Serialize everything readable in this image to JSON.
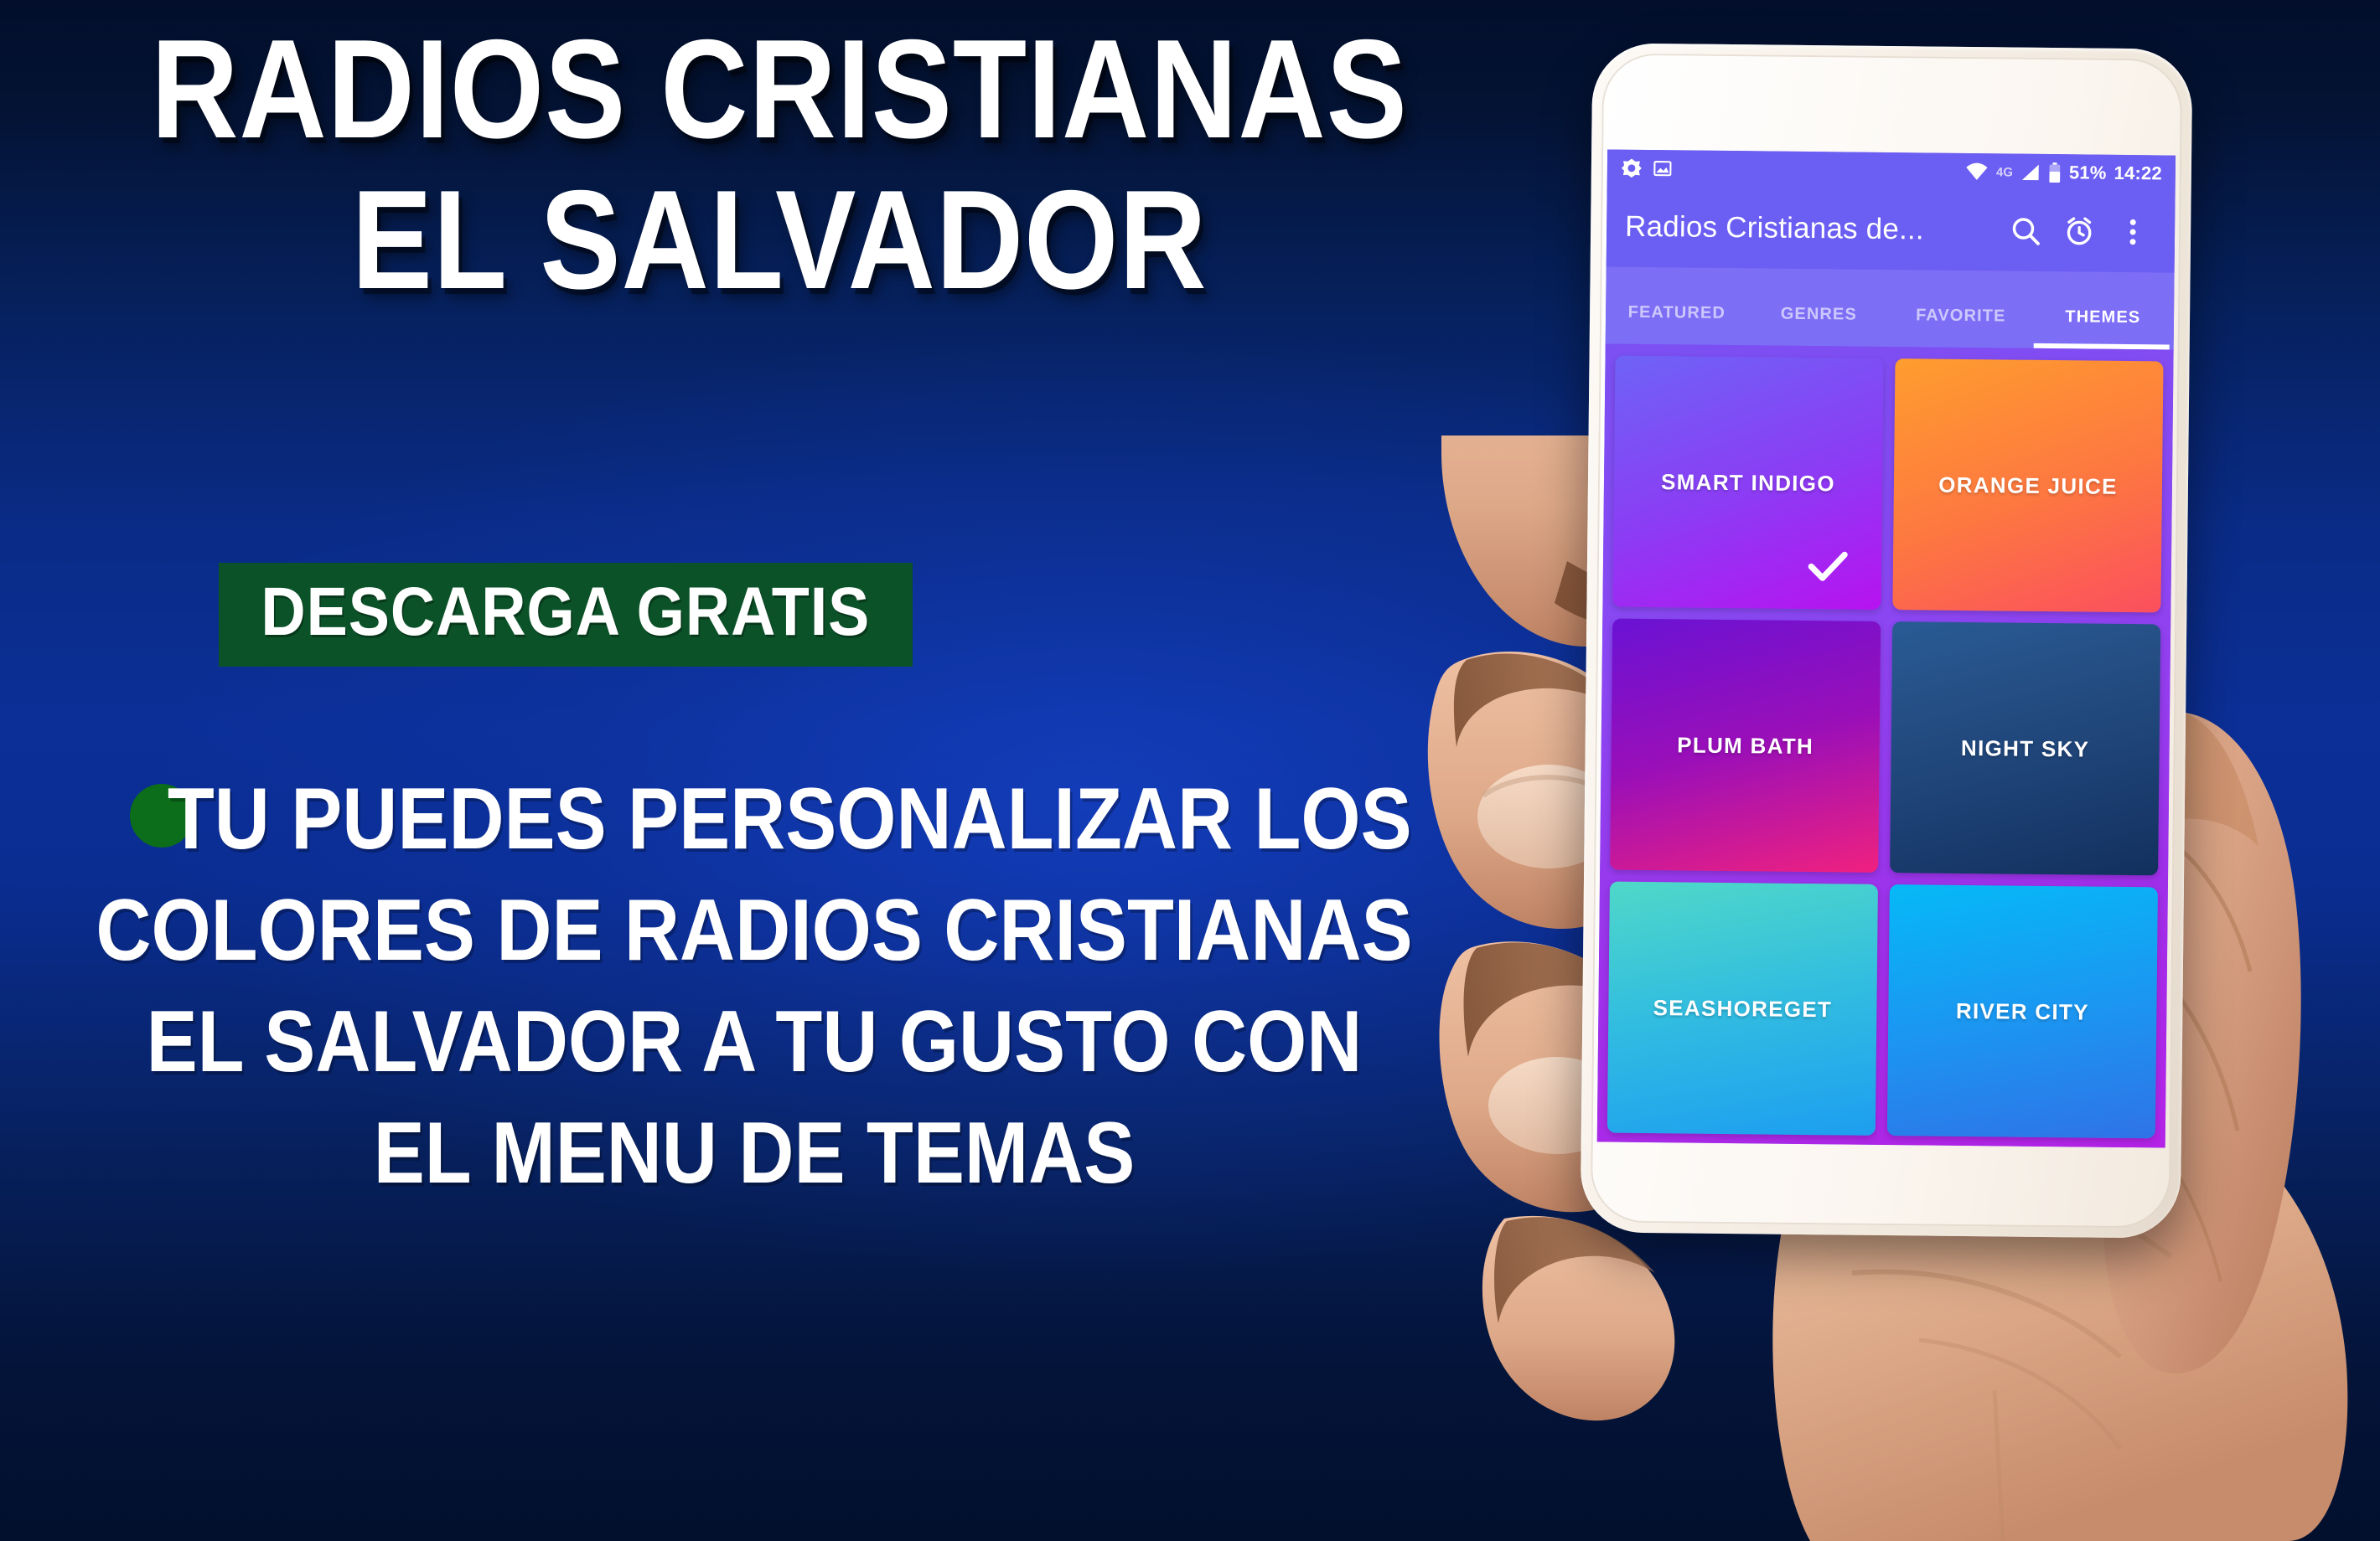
{
  "promo": {
    "headline_line1": "RADIOS CRISTIANAS",
    "headline_line2": "EL SALVADOR",
    "badge_label": "DESCARGA GRATIS",
    "body_lines": [
      "TU PUEDES PERSONALIZAR LOS",
      "COLORES DE RADIOS CRISTIANAS",
      "EL SALVADOR A TU GUSTO CON",
      "EL MENU DE TEMAS"
    ],
    "colors": {
      "background_top": "#02102d",
      "background_mid": "#0b2f97",
      "badge_green": "#0b5228",
      "bullet_green": "#0c6d1b",
      "text_white": "#ffffff"
    }
  },
  "phone": {
    "statusbar": {
      "left_icons": [
        "antivirus-shield-icon",
        "image-notification-icon"
      ],
      "wifi_icon": "wifi-icon",
      "network_label": "4G",
      "signal_icon": "signal-bars-icon",
      "battery_icon": "battery-icon",
      "battery_percent": "51%",
      "clock": "14:22"
    },
    "appbar": {
      "title": "Radios Cristianas de...",
      "actions": [
        {
          "name": "search-icon",
          "label": "Search"
        },
        {
          "name": "alarm-clock-icon",
          "label": "Sleep timer"
        },
        {
          "name": "overflow-menu-icon",
          "label": "More options"
        }
      ],
      "color": "#6b5ef2"
    },
    "tabs": [
      {
        "label": "FEATURED",
        "active": false
      },
      {
        "label": "GENRES",
        "active": false
      },
      {
        "label": "FAVORITE",
        "active": false
      },
      {
        "label": "THEMES",
        "active": true
      }
    ],
    "themes": [
      {
        "name": "SMART INDIGO",
        "selected": true,
        "from": "#6e63f6",
        "to": "#b712f0"
      },
      {
        "name": "ORANGE JUICE",
        "selected": false,
        "from": "#ff9d2e",
        "to": "#fb4f5e"
      },
      {
        "name": "PLUM BATH",
        "selected": true,
        "from": "#6a12d4",
        "to": "#f0217f"
      },
      {
        "name": "NIGHT SKY",
        "selected": false,
        "from": "#2a5b94",
        "to": "#12305e"
      },
      {
        "name": "SEASHOREGET",
        "selected": false,
        "from": "#4fd8c8",
        "to": "#1d9ef0"
      },
      {
        "name": "RIVER CITY",
        "selected": false,
        "from": "#06b9f7",
        "to": "#2f73e8"
      }
    ],
    "grid_background_from": "#7b50f3",
    "grid_background_to": "#b423e6"
  }
}
